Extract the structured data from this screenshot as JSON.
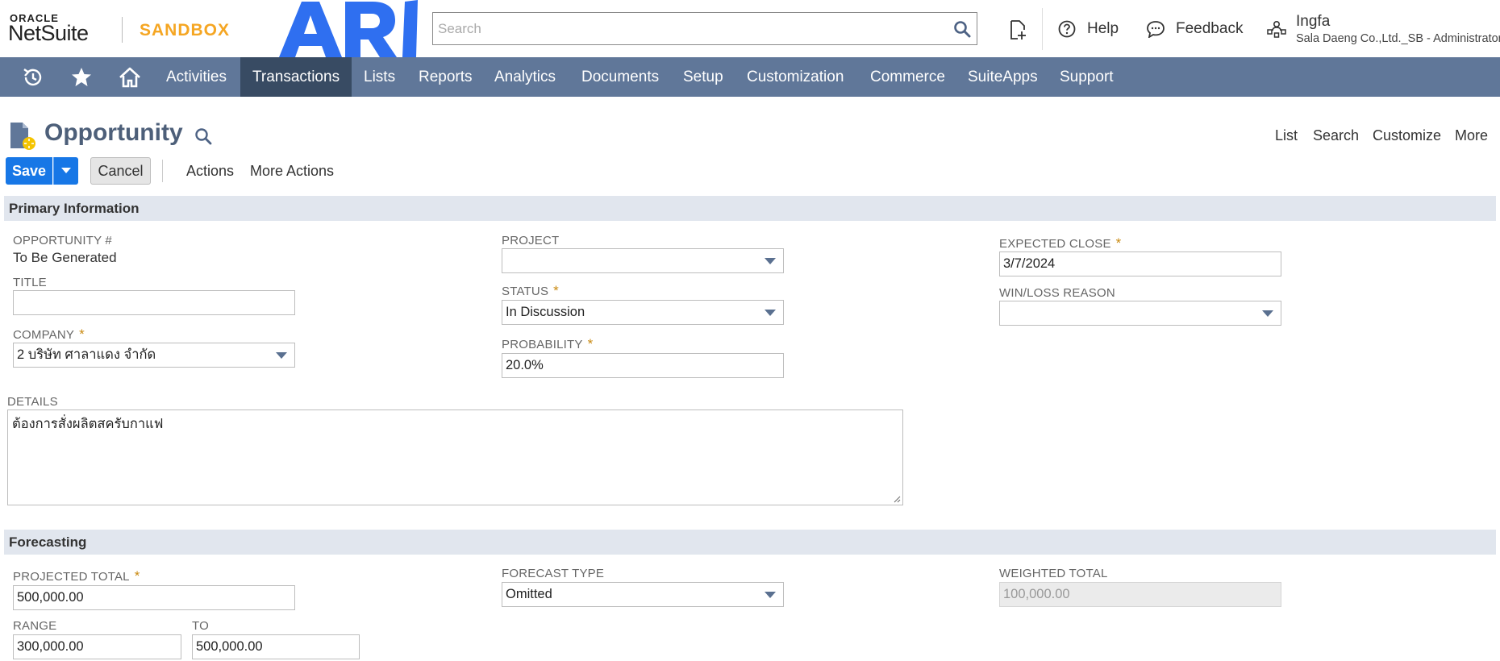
{
  "header": {
    "oracle": "ORACLE",
    "netsuite": "NetSuite",
    "sandbox": "SANDBOX",
    "search_placeholder": "Search",
    "help": "Help",
    "feedback": "Feedback",
    "user_name": "Ingfa",
    "user_role": "Sala Daeng Co.,Ltd._SB - Administrator"
  },
  "nav": {
    "items": [
      "Activities",
      "Transactions",
      "Lists",
      "Reports",
      "Analytics",
      "Documents",
      "Setup",
      "Customization",
      "Commerce",
      "SuiteApps",
      "Support"
    ],
    "active": "Transactions"
  },
  "page": {
    "title": "Opportunity",
    "links": [
      "List",
      "Search",
      "Customize",
      "More"
    ]
  },
  "toolbar": {
    "save": "Save",
    "cancel": "Cancel",
    "actions": "Actions",
    "more_actions": "More Actions"
  },
  "primary": {
    "section_title": "Primary Information",
    "opportunity_label": "OPPORTUNITY #",
    "opportunity_value": "To Be Generated",
    "title_label": "TITLE",
    "title_value": "",
    "company_label": "COMPANY",
    "company_value": "2 บริษัท ศาลาแดง จำกัด",
    "project_label": "PROJECT",
    "project_value": "",
    "status_label": "STATUS",
    "status_value": "In Discussion",
    "probability_label": "PROBABILITY",
    "probability_value": "20.0%",
    "expected_close_label": "EXPECTED CLOSE",
    "expected_close_value": "3/7/2024",
    "winloss_label": "WIN/LOSS REASON",
    "winloss_value": "",
    "details_label": "DETAILS",
    "details_value": "ต้องการสั่งผลิตสครับกาแฟ",
    "required_mark": "*"
  },
  "forecasting": {
    "section_title": "Forecasting",
    "projected_total_label": "PROJECTED TOTAL",
    "projected_total_value": "500,000.00",
    "range_label": "RANGE",
    "range_value": "300,000.00",
    "to_label": "TO",
    "to_value": "500,000.00",
    "forecast_type_label": "FORECAST TYPE",
    "forecast_type_value": "Omitted",
    "weighted_total_label": "WEIGHTED TOTAL",
    "weighted_total_value": "100,000.00"
  },
  "colors": {
    "nav_bg": "#607799",
    "nav_active": "#384b63",
    "primary_button": "#1777e6",
    "section_bg": "#e1e6ee",
    "sandbox": "#f5a623",
    "ari_logo": "#2f6ff0"
  }
}
